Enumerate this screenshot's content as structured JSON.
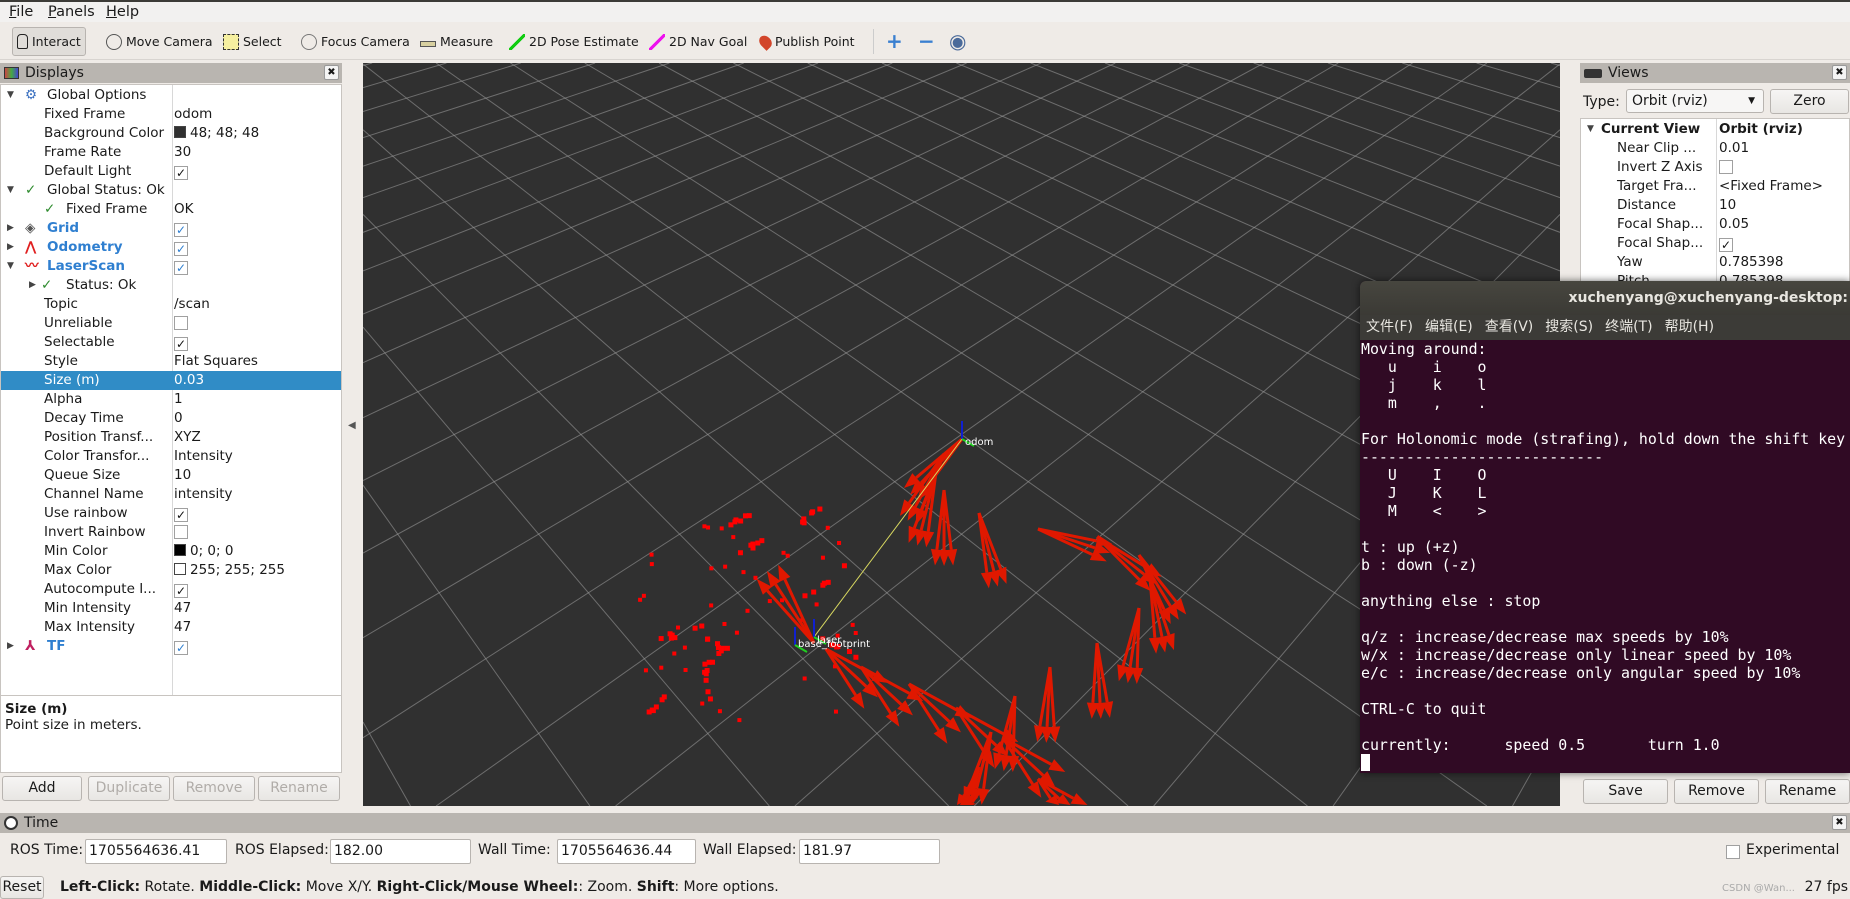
{
  "menu": [
    "File",
    "Panels",
    "Help"
  ],
  "toolbar": {
    "tools": [
      {
        "label": "Interact",
        "icon": "hand-cursor-icon",
        "active": true
      },
      {
        "label": "Move Camera",
        "icon": "move-camera-icon"
      },
      {
        "label": "Select",
        "icon": "select-box-icon"
      },
      {
        "label": "Focus Camera",
        "icon": "focus-camera-icon"
      },
      {
        "label": "Measure",
        "icon": "ruler-icon"
      },
      {
        "label": "2D Pose Estimate",
        "icon": "green-arrow-icon"
      },
      {
        "label": "2D Nav Goal",
        "icon": "magenta-arrow-icon"
      },
      {
        "label": "Publish Point",
        "icon": "map-pin-icon"
      }
    ],
    "extra": [
      "plus-icon",
      "minus-icon",
      "eye-icon"
    ]
  },
  "displays": {
    "title": "Displays",
    "rows": [
      {
        "lvl": 0,
        "arrow": "down",
        "icon": "gear-icon",
        "label": "Global Options"
      },
      {
        "lvl": 1,
        "label": "Fixed Frame",
        "value": "odom"
      },
      {
        "lvl": 1,
        "label": "Background Color",
        "value": "48; 48; 48",
        "swatch": "#303030"
      },
      {
        "lvl": 1,
        "label": "Frame Rate",
        "value": "30"
      },
      {
        "lvl": 1,
        "label": "Default Light",
        "check": true
      },
      {
        "lvl": 0,
        "arrow": "down",
        "icon": "ok",
        "label": "Global Status: Ok"
      },
      {
        "lvl": 2,
        "icon": "ok",
        "label": "Fixed Frame",
        "value": "OK"
      },
      {
        "lvl": 0,
        "arrow": "right",
        "icon": "grid-icon",
        "label": "Grid",
        "blue": true,
        "check": true
      },
      {
        "lvl": 0,
        "arrow": "right",
        "icon": "odometry-icon",
        "label": "Odometry",
        "blue": true,
        "check": true
      },
      {
        "lvl": 0,
        "arrow": "down",
        "icon": "laserscan-icon",
        "label": "LaserScan",
        "blue": true,
        "check": true
      },
      {
        "lvl": 2,
        "arrow": "right",
        "icon": "ok",
        "label": "Status: Ok"
      },
      {
        "lvl": 1,
        "label": "Topic",
        "value": "/scan"
      },
      {
        "lvl": 1,
        "label": "Unreliable",
        "check": false
      },
      {
        "lvl": 1,
        "label": "Selectable",
        "check": true
      },
      {
        "lvl": 1,
        "label": "Style",
        "value": "Flat Squares"
      },
      {
        "lvl": 1,
        "label": "Size (m)",
        "value": "0.03",
        "selected": true
      },
      {
        "lvl": 1,
        "label": "Alpha",
        "value": "1"
      },
      {
        "lvl": 1,
        "label": "Decay Time",
        "value": "0"
      },
      {
        "lvl": 1,
        "label": "Position Transf...",
        "value": "XYZ"
      },
      {
        "lvl": 1,
        "label": "Color Transfor...",
        "value": "Intensity"
      },
      {
        "lvl": 1,
        "label": "Queue Size",
        "value": "10"
      },
      {
        "lvl": 1,
        "label": "Channel Name",
        "value": "intensity"
      },
      {
        "lvl": 1,
        "label": "Use rainbow",
        "check": true
      },
      {
        "lvl": 1,
        "label": "Invert Rainbow",
        "check": false
      },
      {
        "lvl": 1,
        "label": "Min Color",
        "value": "0; 0; 0",
        "swatch": "#000000"
      },
      {
        "lvl": 1,
        "label": "Max Color",
        "value": "255; 255; 255",
        "swatch": "#ffffff"
      },
      {
        "lvl": 1,
        "label": "Autocompute I...",
        "check": true
      },
      {
        "lvl": 1,
        "label": "Min Intensity",
        "value": "47"
      },
      {
        "lvl": 1,
        "label": "Max Intensity",
        "value": "47"
      },
      {
        "lvl": 0,
        "arrow": "right",
        "icon": "tf-icon",
        "label": "TF",
        "blue": true,
        "check": true
      }
    ],
    "desc_title": "Size (m)",
    "desc_text": "Point size in meters.",
    "buttons": [
      {
        "label": "Add",
        "enabled": true
      },
      {
        "label": "Duplicate",
        "enabled": false
      },
      {
        "label": "Remove",
        "enabled": false
      },
      {
        "label": "Rename",
        "enabled": false
      }
    ]
  },
  "viewport": {
    "frames": [
      "odom",
      "laser",
      "base_footprint"
    ],
    "colors": {
      "background": "#303030",
      "odometry": "#e01800",
      "scan": "#ff0000"
    }
  },
  "views": {
    "title": "Views",
    "type_label": "Type:",
    "type_value": "Orbit (rviz)",
    "zero": "Zero",
    "rows": [
      {
        "label": "Current View",
        "value": "Orbit (rviz)",
        "bold": true
      },
      {
        "label": "Near Clip ...",
        "value": "0.01"
      },
      {
        "label": "Invert Z Axis",
        "check": false
      },
      {
        "label": "Target Fra...",
        "value": "<Fixed Frame>"
      },
      {
        "label": "Distance",
        "value": "10"
      },
      {
        "label": "Focal Shap...",
        "value": "0.05"
      },
      {
        "label": "Focal Shap...",
        "check": true
      },
      {
        "label": "Yaw",
        "value": "0.785398"
      },
      {
        "label": "Pitch",
        "value": "0.785398"
      }
    ],
    "buttons": [
      "Save",
      "Remove",
      "Rename"
    ]
  },
  "terminal": {
    "title": "xuchenyang@xuchenyang-desktop:",
    "menu": [
      "文件(F)",
      "编辑(E)",
      "查看(V)",
      "搜索(S)",
      "终端(T)",
      "帮助(H)"
    ],
    "lines": [
      "Moving around:",
      "   u    i    o",
      "   j    k    l",
      "   m    ,    .",
      "",
      "For Holonomic mode (strafing), hold down the shift key",
      "---------------------------",
      "   U    I    O",
      "   J    K    L",
      "   M    <    >",
      "",
      "t : up (+z)",
      "b : down (-z)",
      "",
      "anything else : stop",
      "",
      "q/z : increase/decrease max speeds by 10%",
      "w/x : increase/decrease only linear speed by 10%",
      "e/c : increase/decrease only angular speed by 10%",
      "",
      "CTRL-C to quit",
      "",
      "currently:\tspeed 0.5\tturn 1.0"
    ]
  },
  "time": {
    "title": "Time",
    "ros_time_label": "ROS Time:",
    "ros_time": "1705564636.41",
    "ros_elapsed_label": "ROS Elapsed:",
    "ros_elapsed": "182.00",
    "wall_time_label": "Wall Time:",
    "wall_time": "1705564636.44",
    "wall_elapsed_label": "Wall Elapsed:",
    "wall_elapsed": "181.97",
    "experimental": "Experimental"
  },
  "status": {
    "reset": "Reset",
    "hints": [
      [
        "Left-Click:",
        " Rotate. "
      ],
      [
        "Middle-Click:",
        " Move X/Y. "
      ],
      [
        "Right-Click/Mouse Wheel:",
        ": Zoom. "
      ],
      [
        "Shift",
        ": More options."
      ]
    ],
    "fps": "27 fps",
    "watermark": "CSDN @Wan..."
  }
}
